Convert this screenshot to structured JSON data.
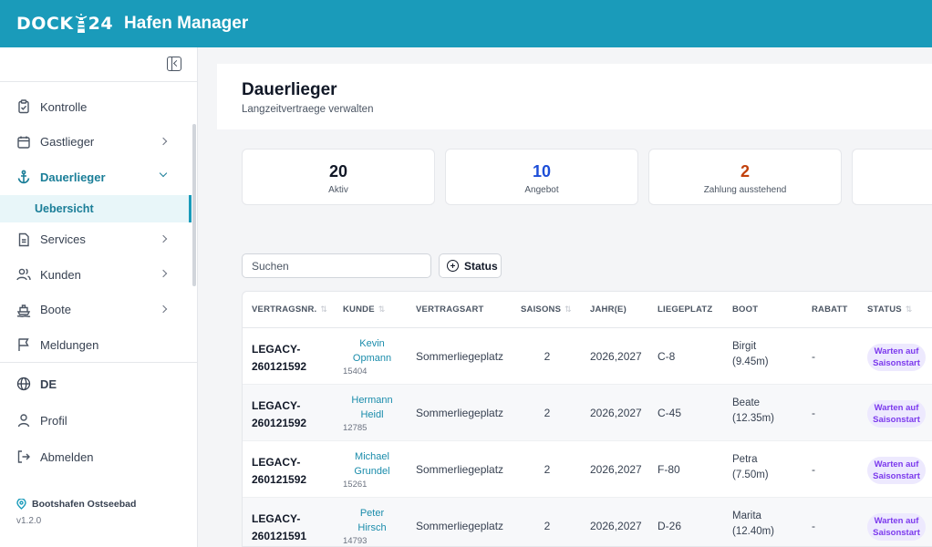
{
  "header": {
    "logo_left": "DOCK",
    "logo_right": "24",
    "app_title": "Hafen Manager"
  },
  "sidebar": {
    "items": [
      {
        "label": "Kontrolle",
        "icon": "clipboard-check-icon"
      },
      {
        "label": "Gastlieger",
        "icon": "calendar-icon"
      },
      {
        "label": "Dauerlieger",
        "icon": "anchor-icon"
      },
      {
        "label": "Services",
        "icon": "document-icon"
      },
      {
        "label": "Kunden",
        "icon": "users-icon"
      },
      {
        "label": "Boote",
        "icon": "boat-icon"
      },
      {
        "label": "Meldungen",
        "icon": "flag-icon"
      }
    ],
    "subitem": "Uebersicht",
    "language": "DE",
    "profile": "Profil",
    "logout": "Abmelden",
    "harbor": "Bootshafen Ostseebad",
    "version": "v1.2.0"
  },
  "page": {
    "title": "Dauerlieger",
    "subtitle": "Langzeitvertraege verwalten"
  },
  "stats": [
    {
      "value": "20",
      "label": "Aktiv",
      "color": "#111827"
    },
    {
      "value": "10",
      "label": "Angebot",
      "color": "#1d4ed8"
    },
    {
      "value": "2",
      "label": "Zahlung ausstehend",
      "color": "#c2410c"
    }
  ],
  "filters": {
    "search_placeholder": "Suchen",
    "status_label": "Status"
  },
  "table": {
    "headers": {
      "contract": "VERTRAGSNR.",
      "customer": "KUNDE",
      "type": "VERTRAGSART",
      "seasons": "SAISONS",
      "years": "JAHR(E)",
      "berth": "LIEGEPLATZ",
      "boat": "BOOT",
      "discount": "RABATT",
      "status": "STATUS"
    },
    "rows": [
      {
        "contract_a": "LEGACY-",
        "contract_b": "260121592",
        "first": "Kevin",
        "last": "Opmann",
        "id": "15404",
        "type": "Sommerliegeplatz",
        "seasons": "2",
        "years": "2026,2027",
        "berth": "C-8",
        "boat": "Birgit",
        "length": "(9.45m)",
        "discount": "-",
        "status_a": "Warten auf",
        "status_b": "Saisonstart"
      },
      {
        "contract_a": "LEGACY-",
        "contract_b": "260121592",
        "first": "Hermann",
        "last": "Heidl",
        "id": "12785",
        "type": "Sommerliegeplatz",
        "seasons": "2",
        "years": "2026,2027",
        "berth": "C-45",
        "boat": "Beate",
        "length": "(12.35m)",
        "discount": "-",
        "status_a": "Warten auf",
        "status_b": "Saisonstart"
      },
      {
        "contract_a": "LEGACY-",
        "contract_b": "260121592",
        "first": "Michael",
        "last": "Grundel",
        "id": "15261",
        "type": "Sommerliegeplatz",
        "seasons": "2",
        "years": "2026,2027",
        "berth": "F-80",
        "boat": "Petra",
        "length": "(7.50m)",
        "discount": "-",
        "status_a": "Warten auf",
        "status_b": "Saisonstart"
      },
      {
        "contract_a": "LEGACY-",
        "contract_b": "260121591",
        "first": "Peter",
        "last": "Hirsch",
        "id": "14793",
        "type": "Sommerliegeplatz",
        "seasons": "2",
        "years": "2026,2027",
        "berth": "D-26",
        "boat": "Marita",
        "length": "(12.40m)",
        "discount": "-",
        "status_a": "Warten auf",
        "status_b": "Saisonstart"
      }
    ]
  }
}
